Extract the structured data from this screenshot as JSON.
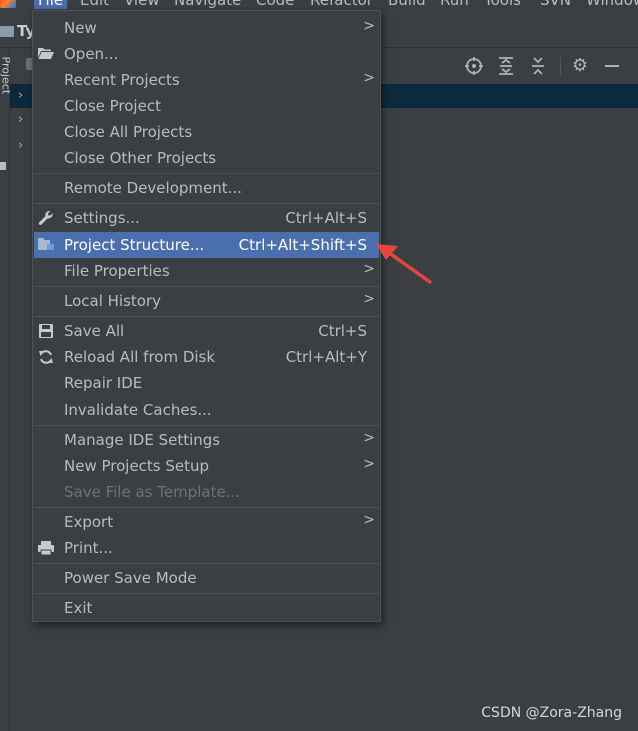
{
  "menubar": {
    "items": [
      "File",
      "Edit",
      "View",
      "Navigate",
      "Code",
      "Refactor",
      "Build",
      "Run",
      "Tools",
      "SVN",
      "Window"
    ],
    "active": "File"
  },
  "title": {
    "project_name": "Ty"
  },
  "left_strip": {
    "label": "Project"
  },
  "file_menu": {
    "new": {
      "label": "New"
    },
    "open": {
      "label": "Open..."
    },
    "recent_projects": {
      "label": "Recent Projects"
    },
    "close_project": {
      "label": "Close Project"
    },
    "close_all_projects": {
      "label": "Close All Projects"
    },
    "close_other_projects": {
      "label": "Close Other Projects"
    },
    "remote_development": {
      "label": "Remote Development..."
    },
    "settings": {
      "label": "Settings...",
      "shortcut": "Ctrl+Alt+S"
    },
    "project_structure": {
      "label": "Project Structure...",
      "shortcut": "Ctrl+Alt+Shift+S"
    },
    "file_properties": {
      "label": "File Properties"
    },
    "local_history": {
      "label": "Local History"
    },
    "save_all": {
      "label": "Save All",
      "shortcut": "Ctrl+S"
    },
    "reload_all": {
      "label": "Reload All from Disk",
      "shortcut": "Ctrl+Alt+Y"
    },
    "repair_ide": {
      "label": "Repair IDE"
    },
    "invalidate_caches": {
      "label": "Invalidate Caches..."
    },
    "manage_ide_settings": {
      "label": "Manage IDE Settings"
    },
    "new_projects_setup": {
      "label": "New Projects Setup"
    },
    "save_file_as_template": {
      "label": "Save File as Template..."
    },
    "export": {
      "label": "Export"
    },
    "print": {
      "label": "Print..."
    },
    "power_save_mode": {
      "label": "Power Save Mode"
    },
    "exit": {
      "label": "Exit"
    }
  },
  "watermark": "CSDN @Zora-Zhang",
  "colors": {
    "highlight": "#4b6eaf",
    "background": "#3c3f41",
    "annotation_arrow": "#e8453c"
  }
}
